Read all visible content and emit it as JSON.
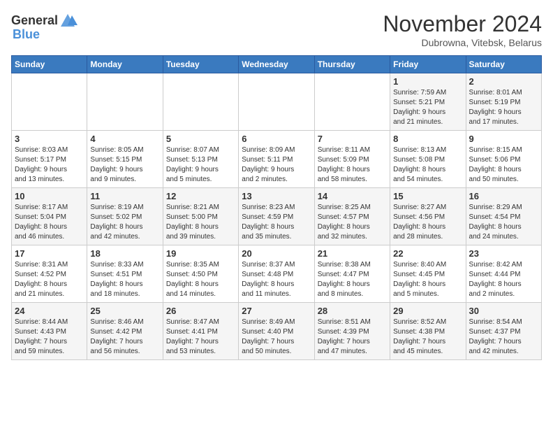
{
  "header": {
    "logo_general": "General",
    "logo_blue": "Blue",
    "title": "November 2024",
    "subtitle": "Dubrowna, Vitebsk, Belarus"
  },
  "weekdays": [
    "Sunday",
    "Monday",
    "Tuesday",
    "Wednesday",
    "Thursday",
    "Friday",
    "Saturday"
  ],
  "weeks": [
    [
      {
        "day": "",
        "info": ""
      },
      {
        "day": "",
        "info": ""
      },
      {
        "day": "",
        "info": ""
      },
      {
        "day": "",
        "info": ""
      },
      {
        "day": "",
        "info": ""
      },
      {
        "day": "1",
        "info": "Sunrise: 7:59 AM\nSunset: 5:21 PM\nDaylight: 9 hours\nand 21 minutes."
      },
      {
        "day": "2",
        "info": "Sunrise: 8:01 AM\nSunset: 5:19 PM\nDaylight: 9 hours\nand 17 minutes."
      }
    ],
    [
      {
        "day": "3",
        "info": "Sunrise: 8:03 AM\nSunset: 5:17 PM\nDaylight: 9 hours\nand 13 minutes."
      },
      {
        "day": "4",
        "info": "Sunrise: 8:05 AM\nSunset: 5:15 PM\nDaylight: 9 hours\nand 9 minutes."
      },
      {
        "day": "5",
        "info": "Sunrise: 8:07 AM\nSunset: 5:13 PM\nDaylight: 9 hours\nand 5 minutes."
      },
      {
        "day": "6",
        "info": "Sunrise: 8:09 AM\nSunset: 5:11 PM\nDaylight: 9 hours\nand 2 minutes."
      },
      {
        "day": "7",
        "info": "Sunrise: 8:11 AM\nSunset: 5:09 PM\nDaylight: 8 hours\nand 58 minutes."
      },
      {
        "day": "8",
        "info": "Sunrise: 8:13 AM\nSunset: 5:08 PM\nDaylight: 8 hours\nand 54 minutes."
      },
      {
        "day": "9",
        "info": "Sunrise: 8:15 AM\nSunset: 5:06 PM\nDaylight: 8 hours\nand 50 minutes."
      }
    ],
    [
      {
        "day": "10",
        "info": "Sunrise: 8:17 AM\nSunset: 5:04 PM\nDaylight: 8 hours\nand 46 minutes."
      },
      {
        "day": "11",
        "info": "Sunrise: 8:19 AM\nSunset: 5:02 PM\nDaylight: 8 hours\nand 42 minutes."
      },
      {
        "day": "12",
        "info": "Sunrise: 8:21 AM\nSunset: 5:00 PM\nDaylight: 8 hours\nand 39 minutes."
      },
      {
        "day": "13",
        "info": "Sunrise: 8:23 AM\nSunset: 4:59 PM\nDaylight: 8 hours\nand 35 minutes."
      },
      {
        "day": "14",
        "info": "Sunrise: 8:25 AM\nSunset: 4:57 PM\nDaylight: 8 hours\nand 32 minutes."
      },
      {
        "day": "15",
        "info": "Sunrise: 8:27 AM\nSunset: 4:56 PM\nDaylight: 8 hours\nand 28 minutes."
      },
      {
        "day": "16",
        "info": "Sunrise: 8:29 AM\nSunset: 4:54 PM\nDaylight: 8 hours\nand 24 minutes."
      }
    ],
    [
      {
        "day": "17",
        "info": "Sunrise: 8:31 AM\nSunset: 4:52 PM\nDaylight: 8 hours\nand 21 minutes."
      },
      {
        "day": "18",
        "info": "Sunrise: 8:33 AM\nSunset: 4:51 PM\nDaylight: 8 hours\nand 18 minutes."
      },
      {
        "day": "19",
        "info": "Sunrise: 8:35 AM\nSunset: 4:50 PM\nDaylight: 8 hours\nand 14 minutes."
      },
      {
        "day": "20",
        "info": "Sunrise: 8:37 AM\nSunset: 4:48 PM\nDaylight: 8 hours\nand 11 minutes."
      },
      {
        "day": "21",
        "info": "Sunrise: 8:38 AM\nSunset: 4:47 PM\nDaylight: 8 hours\nand 8 minutes."
      },
      {
        "day": "22",
        "info": "Sunrise: 8:40 AM\nSunset: 4:45 PM\nDaylight: 8 hours\nand 5 minutes."
      },
      {
        "day": "23",
        "info": "Sunrise: 8:42 AM\nSunset: 4:44 PM\nDaylight: 8 hours\nand 2 minutes."
      }
    ],
    [
      {
        "day": "24",
        "info": "Sunrise: 8:44 AM\nSunset: 4:43 PM\nDaylight: 7 hours\nand 59 minutes."
      },
      {
        "day": "25",
        "info": "Sunrise: 8:46 AM\nSunset: 4:42 PM\nDaylight: 7 hours\nand 56 minutes."
      },
      {
        "day": "26",
        "info": "Sunrise: 8:47 AM\nSunset: 4:41 PM\nDaylight: 7 hours\nand 53 minutes."
      },
      {
        "day": "27",
        "info": "Sunrise: 8:49 AM\nSunset: 4:40 PM\nDaylight: 7 hours\nand 50 minutes."
      },
      {
        "day": "28",
        "info": "Sunrise: 8:51 AM\nSunset: 4:39 PM\nDaylight: 7 hours\nand 47 minutes."
      },
      {
        "day": "29",
        "info": "Sunrise: 8:52 AM\nSunset: 4:38 PM\nDaylight: 7 hours\nand 45 minutes."
      },
      {
        "day": "30",
        "info": "Sunrise: 8:54 AM\nSunset: 4:37 PM\nDaylight: 7 hours\nand 42 minutes."
      }
    ]
  ]
}
